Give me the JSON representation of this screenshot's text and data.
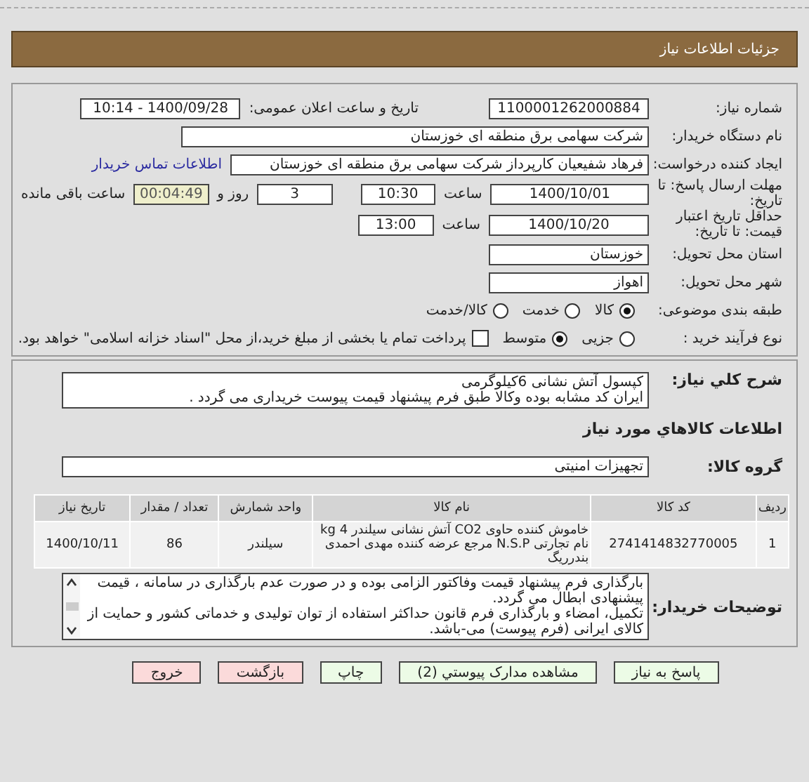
{
  "header": {
    "title": "جزئیات اطلاعات نیاز"
  },
  "form": {
    "need_number": {
      "label": "شماره نیاز:",
      "value": "1100001262000884"
    },
    "announce": {
      "label": "تاریخ و ساعت اعلان عمومی:",
      "value": "1400/09/28 - 10:14"
    },
    "buyer": {
      "label": "نام دستگاه خریدار:",
      "value": "شرکت سهامی برق منطقه ای خوزستان"
    },
    "creator": {
      "label": "ایجاد کننده درخواست:",
      "value": "فرهاد شفیعیان کارپرداز شرکت سهامی برق منطقه ای خوزستان",
      "link": "اطلاعات تماس خریدار"
    },
    "deadline": {
      "label": "مهلت ارسال پاسخ: تا تاریخ:",
      "date": "1400/10/01",
      "time_label": "ساعت",
      "time": "10:30",
      "days": "3",
      "days_label": "روز و",
      "remaining": "00:04:49",
      "remaining_label": "ساعت باقی مانده"
    },
    "validity": {
      "label": "حداقل تاریخ اعتبار قیمت: تا تاریخ:",
      "date": "1400/10/20",
      "time_label": "ساعت",
      "time": "13:00"
    },
    "province": {
      "label": "استان محل تحویل:",
      "value": "خوزستان"
    },
    "city": {
      "label": "شهر محل تحویل:",
      "value": "اهواز"
    },
    "category": {
      "label": "طبقه بندی موضوعی:",
      "options": [
        {
          "label": "کالا",
          "selected": true
        },
        {
          "label": "خدمت",
          "selected": false
        },
        {
          "label": "کالا/خدمت",
          "selected": false
        }
      ]
    },
    "process": {
      "label": "نوع فرآیند خرید :",
      "options": [
        {
          "label": "جزیی",
          "selected": false
        },
        {
          "label": "متوسط",
          "selected": true
        }
      ],
      "treasury": {
        "label": "پرداخت تمام یا بخشی از مبلغ خرید،از محل \"اسناد خزانه اسلامی\" خواهد بود.",
        "checked": false
      }
    }
  },
  "summary": {
    "label": "شرح کلي نیاز:",
    "lines": [
      "کپسول آتش نشانی 6کیلوگرمی",
      "ایران کد مشابه بوده وکالا طبق فرم پیشنهاد قیمت پیوست خریداری می گردد ."
    ]
  },
  "goods_heading": "اطلاعات کالاهاي مورد نیاز",
  "goods_group": {
    "label": "گروه کالا:",
    "value": "تجهیزات امنیتی"
  },
  "table": {
    "columns": [
      "ردیف",
      "کد کالا",
      "نام کالا",
      "واحد شمارش",
      "تعداد / مقدار",
      "تاریخ نیاز"
    ],
    "rows": [
      [
        "1",
        "2741414832770005",
        "خاموش کننده حاوی CO2 آتش نشانی سیلندر 4 kg نام تجارتی N.S.P مرجع عرضه کننده مهدی احمدی بندرریگ",
        "سیلندر",
        "86",
        "1400/10/11"
      ]
    ]
  },
  "buyer_notes": {
    "label": "توضیحات خریدار:",
    "lines": [
      "بارگذاری فرم پیشنهاد قیمت وفاکتور الزامی بوده و در صورت عدم بارگذاری در سامانه ، قیمت پیشنهادی ابطال می گردد.",
      "تکمیل، امضاء و بارگذاری فرم قانون حداکثر استفاده از توان تولیدی و خدماتی کشور و حمایت از کالای ایرانی (فرم پیوست) می-باشد."
    ]
  },
  "buttons": [
    {
      "label": "پاسخ به نیاز",
      "kind": "normal"
    },
    {
      "label": "مشاهده مدارک پیوستي (2)",
      "kind": "normal"
    },
    {
      "label": "چاپ",
      "kind": "normal"
    },
    {
      "label": "بازگشت",
      "kind": "danger"
    },
    {
      "label": "خروج",
      "kind": "danger"
    }
  ]
}
